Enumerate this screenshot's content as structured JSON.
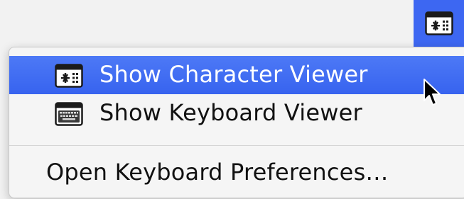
{
  "menubar": {
    "icon": "character-viewer-icon",
    "accent_color": "#3d67f2"
  },
  "menu": {
    "items": [
      {
        "label": "Show Character Viewer",
        "icon": "character-viewer-icon",
        "highlighted": true
      },
      {
        "label": "Show Keyboard Viewer",
        "icon": "keyboard-viewer-icon",
        "highlighted": false
      },
      {
        "label": "Open Keyboard Preferences…",
        "icon": "",
        "highlighted": false
      }
    ]
  },
  "colors": {
    "highlight": "#3d67f2",
    "menu_background": "#f5f5f5",
    "text": "#111111"
  }
}
